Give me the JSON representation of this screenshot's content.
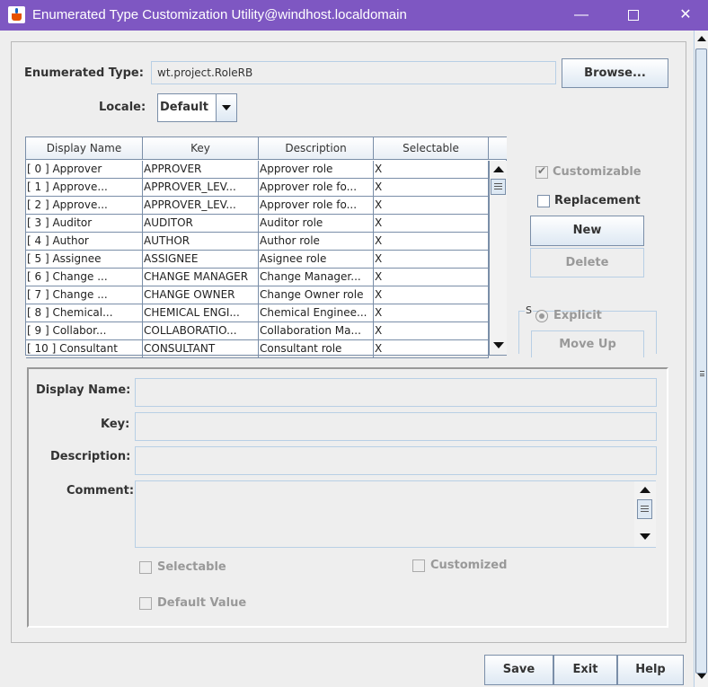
{
  "window": {
    "title": "Enumerated Type Customization Utility@windhost.localdomain",
    "minimize": "—",
    "close": "✕"
  },
  "header": {
    "enum_type_label": "Enumerated Type:",
    "enum_type_value": "wt.project.RoleRB",
    "browse_label": "Browse...",
    "locale_label": "Locale:",
    "locale_value": "Default"
  },
  "table": {
    "columns": [
      "Display Name",
      "Key",
      "Description",
      "Selectable"
    ],
    "rows": [
      [
        "[  0 ]  Approver",
        "APPROVER",
        "Approver role",
        "X"
      ],
      [
        "[  1 ]  Approve...",
        "APPROVER_LEV...",
        "Approver role fo...",
        "X"
      ],
      [
        "[  2 ]  Approve...",
        "APPROVER_LEV...",
        "Approver role fo...",
        "X"
      ],
      [
        "[  3 ]  Auditor",
        "AUDITOR",
        "Auditor role",
        "X"
      ],
      [
        "[  4 ]  Author",
        "AUTHOR",
        "Author role",
        "X"
      ],
      [
        "[  5 ]  Assignee",
        "ASSIGNEE",
        "Asignee role",
        "X"
      ],
      [
        "[  6 ]  Change ...",
        "CHANGE MANAGER",
        "Change Manager...",
        "X"
      ],
      [
        "[  7 ]  Change ...",
        "CHANGE OWNER",
        "Change Owner role",
        "X"
      ],
      [
        "[  8 ]  Chemical...",
        "CHEMICAL ENGI...",
        "Chemical Enginee...",
        "X"
      ],
      [
        "[  9 ]  Collabor...",
        "COLLABORATIO...",
        "Collaboration Ma...",
        "X"
      ],
      [
        "[ 10 ]  Consultant",
        "CONSULTANT",
        "Consultant role",
        "X"
      ]
    ]
  },
  "side": {
    "customizable_label": "Customizable",
    "replacement_label": "Replacement",
    "new_label": "New",
    "delete_label": "Delete",
    "group_title": "S",
    "explicit_label": "Explicit",
    "move_up_label": "Move Up"
  },
  "detail": {
    "display_name_label": "Display Name:",
    "key_label": "Key:",
    "description_label": "Description:",
    "comment_label": "Comment:",
    "selectable_label": "Selectable",
    "customized_label": "Customized",
    "default_value_label": "Default Value"
  },
  "footer": {
    "save_label": "Save",
    "exit_label": "Exit",
    "help_label": "Help"
  }
}
